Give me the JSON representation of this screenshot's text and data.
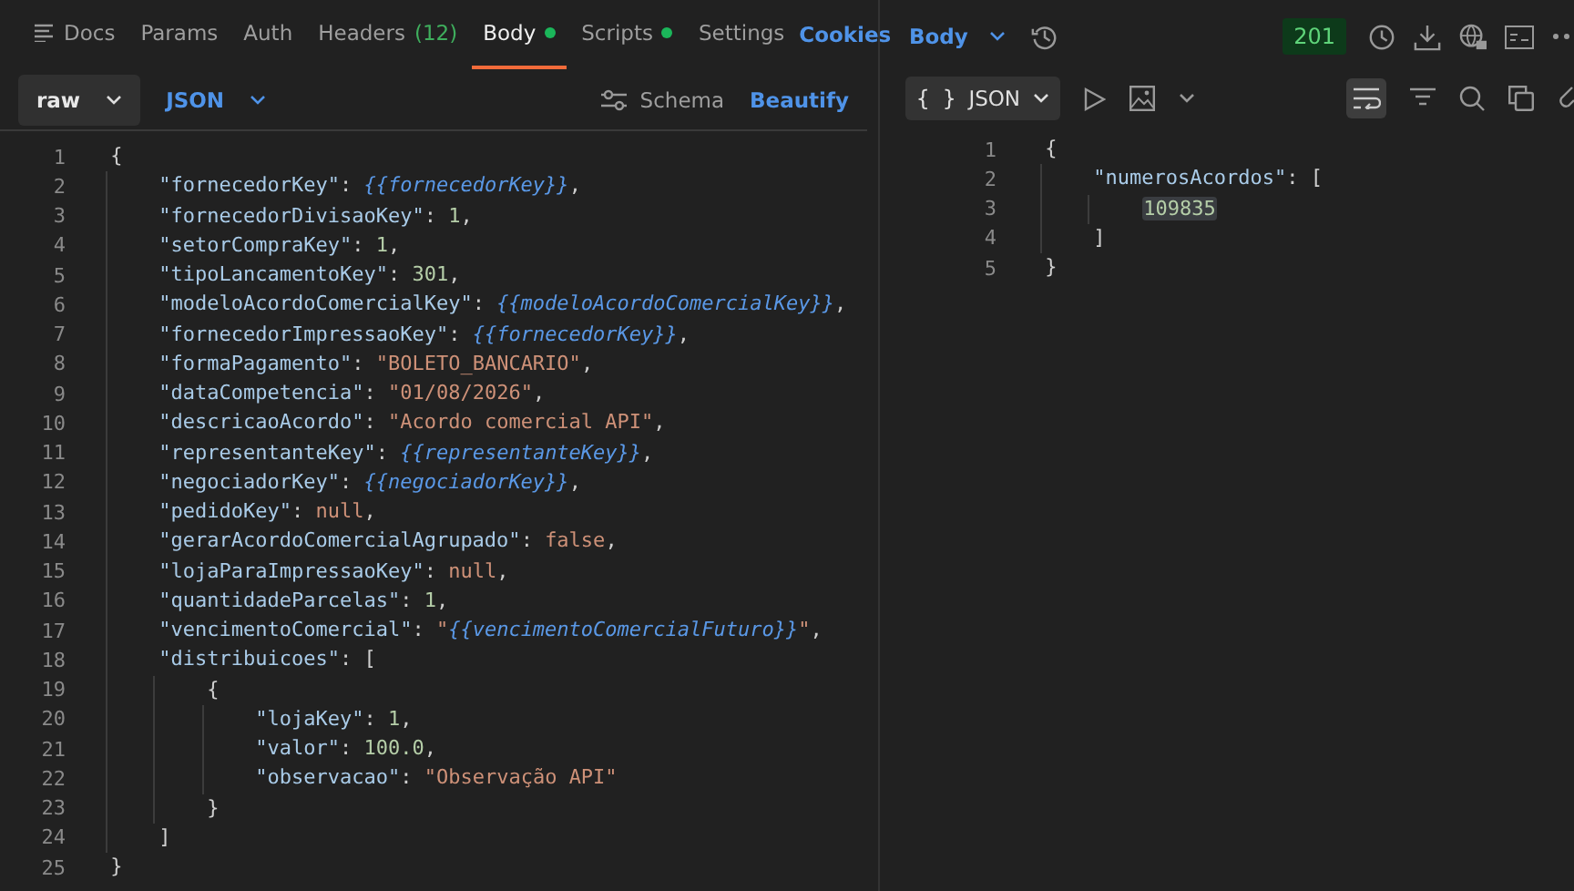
{
  "request": {
    "tabs": [
      {
        "label": "Docs",
        "icon": true,
        "dot": false,
        "selected": false
      },
      {
        "label": "Params",
        "icon": false,
        "dot": false,
        "selected": false
      },
      {
        "label": "Auth",
        "icon": false,
        "dot": false,
        "selected": false
      },
      {
        "label": "Headers",
        "count": "(12)",
        "icon": false,
        "dot": false,
        "selected": false
      },
      {
        "label": "Body",
        "icon": false,
        "dot": true,
        "selected": true
      },
      {
        "label": "Scripts",
        "icon": false,
        "dot": true,
        "selected": false
      },
      {
        "label": "Settings",
        "icon": false,
        "dot": false,
        "selected": false
      }
    ],
    "cookies_link": "Cookies",
    "body_mode": "raw",
    "language": "JSON",
    "schema_button": "Schema",
    "beautify_button": "Beautify",
    "code": [
      {
        "num": "1",
        "tokens": [
          {
            "kind": "punct",
            "text": "{"
          }
        ]
      },
      {
        "num": "2",
        "tokens": [
          {
            "kind": "key",
            "text": "    \"fornecedorKey\""
          },
          {
            "kind": "punct",
            "text": ": "
          },
          {
            "kind": "variable",
            "text": "{{fornecedorKey}}"
          },
          {
            "kind": "punct",
            "text": ","
          }
        ]
      },
      {
        "num": "3",
        "tokens": [
          {
            "kind": "key",
            "text": "    \"fornecedorDivisaoKey\""
          },
          {
            "kind": "punct",
            "text": ": "
          },
          {
            "kind": "number",
            "text": "1"
          },
          {
            "kind": "punct",
            "text": ","
          }
        ]
      },
      {
        "num": "4",
        "tokens": [
          {
            "kind": "key",
            "text": "    \"setorCompraKey\""
          },
          {
            "kind": "punct",
            "text": ": "
          },
          {
            "kind": "number",
            "text": "1"
          },
          {
            "kind": "punct",
            "text": ","
          }
        ]
      },
      {
        "num": "5",
        "tokens": [
          {
            "kind": "key",
            "text": "    \"tipoLancamentoKey\""
          },
          {
            "kind": "punct",
            "text": ": "
          },
          {
            "kind": "number",
            "text": "301"
          },
          {
            "kind": "punct",
            "text": ","
          }
        ]
      },
      {
        "num": "6",
        "tokens": [
          {
            "kind": "key",
            "text": "    \"modeloAcordoComercialKey\""
          },
          {
            "kind": "punct",
            "text": ": "
          },
          {
            "kind": "variable",
            "text": "{{modeloAcordoComercialKey}}"
          },
          {
            "kind": "punct",
            "text": ","
          }
        ]
      },
      {
        "num": "7",
        "tokens": [
          {
            "kind": "key",
            "text": "    \"fornecedorImpressaoKey\""
          },
          {
            "kind": "punct",
            "text": ": "
          },
          {
            "kind": "variable",
            "text": "{{fornecedorKey}}"
          },
          {
            "kind": "punct",
            "text": ","
          }
        ]
      },
      {
        "num": "8",
        "tokens": [
          {
            "kind": "key",
            "text": "    \"formaPagamento\""
          },
          {
            "kind": "punct",
            "text": ": "
          },
          {
            "kind": "string",
            "text": "\"BOLETO_BANCARIO\""
          },
          {
            "kind": "punct",
            "text": ","
          }
        ]
      },
      {
        "num": "9",
        "tokens": [
          {
            "kind": "key",
            "text": "    \"dataCompetencia\""
          },
          {
            "kind": "punct",
            "text": ": "
          },
          {
            "kind": "string",
            "text": "\"01/08/2026\""
          },
          {
            "kind": "punct",
            "text": ","
          }
        ]
      },
      {
        "num": "10",
        "tokens": [
          {
            "kind": "key",
            "text": "    \"descricaoAcordo\""
          },
          {
            "kind": "punct",
            "text": ": "
          },
          {
            "kind": "string",
            "text": "\"Acordo comercial API\""
          },
          {
            "kind": "punct",
            "text": ","
          }
        ]
      },
      {
        "num": "11",
        "tokens": [
          {
            "kind": "key",
            "text": "    \"representanteKey\""
          },
          {
            "kind": "punct",
            "text": ": "
          },
          {
            "kind": "variable",
            "text": "{{representanteKey}}"
          },
          {
            "kind": "punct",
            "text": ","
          }
        ]
      },
      {
        "num": "12",
        "tokens": [
          {
            "kind": "key",
            "text": "    \"negociadorKey\""
          },
          {
            "kind": "punct",
            "text": ": "
          },
          {
            "kind": "variable",
            "text": "{{negociadorKey}}"
          },
          {
            "kind": "punct",
            "text": ","
          }
        ]
      },
      {
        "num": "13",
        "tokens": [
          {
            "kind": "key",
            "text": "    \"pedidoKey\""
          },
          {
            "kind": "punct",
            "text": ": "
          },
          {
            "kind": "keyword",
            "text": "null"
          },
          {
            "kind": "punct",
            "text": ","
          }
        ]
      },
      {
        "num": "14",
        "tokens": [
          {
            "kind": "key",
            "text": "    \"gerarAcordoComercialAgrupado\""
          },
          {
            "kind": "punct",
            "text": ": "
          },
          {
            "kind": "keyword",
            "text": "false"
          },
          {
            "kind": "punct",
            "text": ","
          }
        ]
      },
      {
        "num": "15",
        "tokens": [
          {
            "kind": "key",
            "text": "    \"lojaParaImpressaoKey\""
          },
          {
            "kind": "punct",
            "text": ": "
          },
          {
            "kind": "keyword",
            "text": "null"
          },
          {
            "kind": "punct",
            "text": ","
          }
        ]
      },
      {
        "num": "16",
        "tokens": [
          {
            "kind": "key",
            "text": "    \"quantidadeParcelas\""
          },
          {
            "kind": "punct",
            "text": ": "
          },
          {
            "kind": "number",
            "text": "1"
          },
          {
            "kind": "punct",
            "text": ","
          }
        ]
      },
      {
        "num": "17",
        "tokens": [
          {
            "kind": "key",
            "text": "    \"vencimentoComercial\""
          },
          {
            "kind": "punct",
            "text": ": "
          },
          {
            "kind": "string",
            "text": "\""
          },
          {
            "kind": "variable",
            "text": "{{vencimentoComercialFuturo}}"
          },
          {
            "kind": "string",
            "text": "\""
          },
          {
            "kind": "punct",
            "text": ","
          }
        ]
      },
      {
        "num": "18",
        "tokens": [
          {
            "kind": "key",
            "text": "    \"distribuicoes\""
          },
          {
            "kind": "punct",
            "text": ": ["
          }
        ]
      },
      {
        "num": "19",
        "tokens": [
          {
            "kind": "punct",
            "text": "        {"
          }
        ]
      },
      {
        "num": "20",
        "tokens": [
          {
            "kind": "key",
            "text": "            \"lojaKey\""
          },
          {
            "kind": "punct",
            "text": ": "
          },
          {
            "kind": "number",
            "text": "1"
          },
          {
            "kind": "punct",
            "text": ","
          }
        ]
      },
      {
        "num": "21",
        "tokens": [
          {
            "kind": "key",
            "text": "            \"valor\""
          },
          {
            "kind": "punct",
            "text": ": "
          },
          {
            "kind": "number",
            "text": "100.0"
          },
          {
            "kind": "punct",
            "text": ","
          }
        ]
      },
      {
        "num": "22",
        "tokens": [
          {
            "kind": "key",
            "text": "            \"observacao\""
          },
          {
            "kind": "punct",
            "text": ": "
          },
          {
            "kind": "string",
            "text": "\"Observação API\""
          }
        ]
      },
      {
        "num": "23",
        "tokens": [
          {
            "kind": "punct",
            "text": "        }"
          }
        ]
      },
      {
        "num": "24",
        "tokens": [
          {
            "kind": "punct",
            "text": "    ]"
          }
        ]
      },
      {
        "num": "25",
        "tokens": [
          {
            "kind": "punct",
            "text": "}"
          }
        ]
      }
    ]
  },
  "response": {
    "view": "Body",
    "status": "201",
    "format": "JSON",
    "format_icon": "{ }",
    "wrap_on": true,
    "code": [
      {
        "num": "1",
        "tokens": [
          {
            "kind": "punct",
            "text": "{"
          }
        ]
      },
      {
        "num": "2",
        "tokens": [
          {
            "kind": "key",
            "text": "    \"numerosAcordos\""
          },
          {
            "kind": "punct",
            "text": ": ["
          }
        ]
      },
      {
        "num": "3",
        "tokens": [
          {
            "kind": "number",
            "text": "        109835",
            "highlighted": true
          }
        ]
      },
      {
        "num": "4",
        "tokens": [
          {
            "kind": "punct",
            "text": "    ]"
          }
        ]
      },
      {
        "num": "5",
        "tokens": [
          {
            "kind": "punct",
            "text": "}"
          }
        ]
      }
    ]
  }
}
